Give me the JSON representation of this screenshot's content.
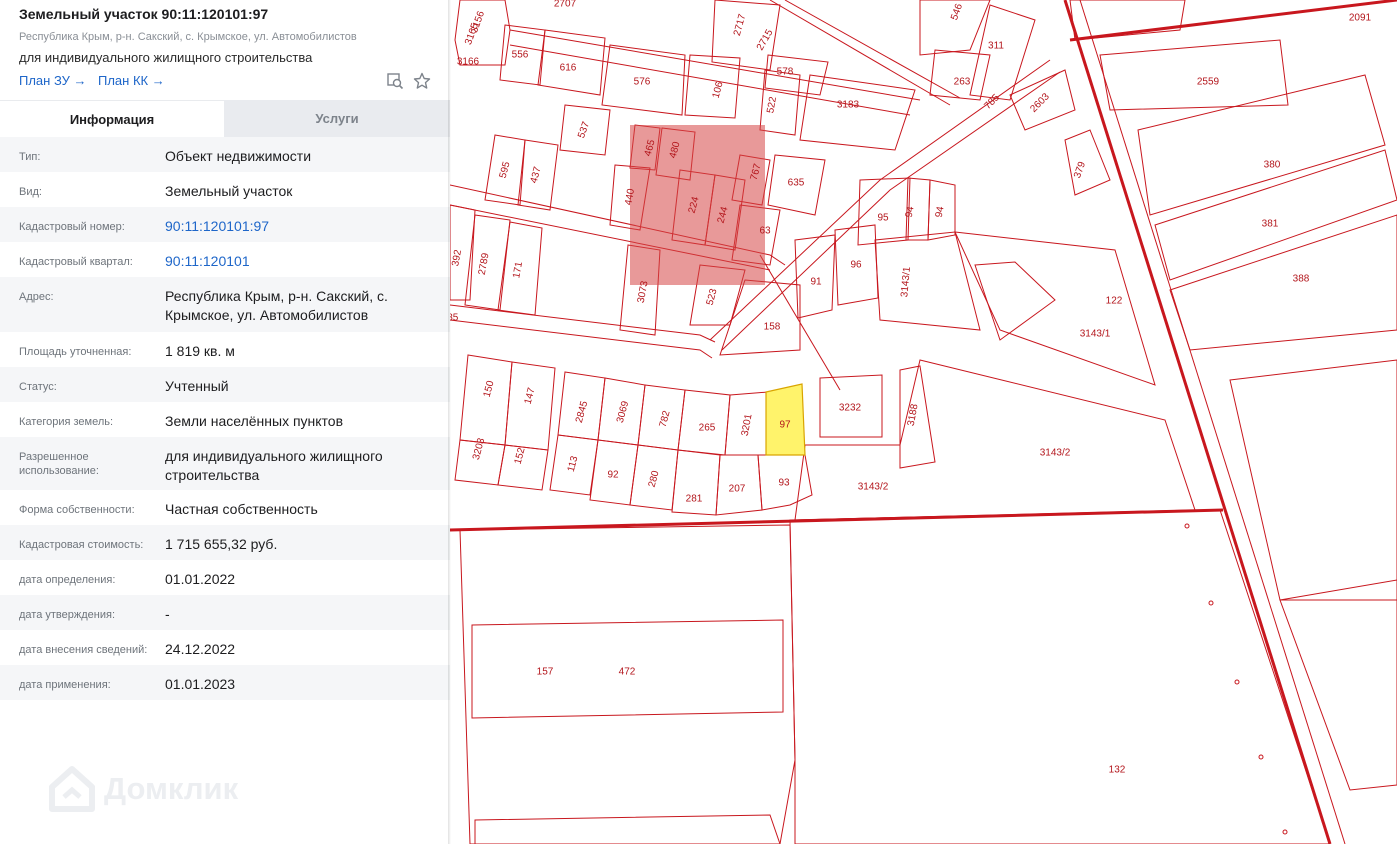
{
  "header": {
    "title": "Земельный участок 90:11:120101:97",
    "address_line": "Республика Крым, р-н. Сакский, с. Крымское, ул. Автомобилистов",
    "use": "для индивидуального жилищного строительства",
    "links": [
      "План ЗУ →",
      "План КК →"
    ],
    "icons": [
      "map-search-icon",
      "star-icon"
    ]
  },
  "tabs": [
    "Информация",
    "Услуги"
  ],
  "rows": [
    {
      "label": "Тип:",
      "value": "Объект недвижимости"
    },
    {
      "label": "Вид:",
      "value": "Земельный участок"
    },
    {
      "label": "Кадастровый номер:",
      "value": "90:11:120101:97",
      "link": true
    },
    {
      "label": "Кадастровый квартал:",
      "value": "90:11:120101",
      "link": true
    },
    {
      "label": "Адрес:",
      "value": "Республика Крым, р-н. Сакский, с. Крымское, ул. Автомобилистов"
    },
    {
      "label": "Площадь уточненная:",
      "value": "1 819 кв. м"
    },
    {
      "label": "Статус:",
      "value": "Учтенный"
    },
    {
      "label": "Категория земель:",
      "value": "Земли населённых пунктов"
    },
    {
      "label": "Разрешенное использование:",
      "value": "для индивидуального жилищного строительства"
    },
    {
      "label": "Форма собственности:",
      "value": "Частная собственность"
    },
    {
      "label": "Кадастровая стоимость:",
      "value": "1 715 655,32 руб."
    },
    {
      "label": "дата определения:",
      "value": "01.01.2022"
    },
    {
      "label": "дата утверждения:",
      "value": "-"
    },
    {
      "label": "дата внесения сведений:",
      "value": "24.12.2022"
    },
    {
      "label": "дата применения:",
      "value": "01.01.2023"
    }
  ],
  "watermark": "Домклик",
  "map": {
    "line_color": "#c8171e",
    "highlight_fill": "#fff36b",
    "parcel_labels": [
      "2707",
      "3166",
      "3165",
      "3156",
      "556",
      "616",
      "576",
      "106",
      "2717",
      "2715",
      "578",
      "546",
      "311",
      "263",
      "2091",
      "522",
      "3183",
      "785",
      "2603",
      "2559",
      "537",
      "465",
      "480",
      "767",
      "635",
      "595",
      "437",
      "440",
      "224",
      "244",
      "63",
      "95",
      "94",
      "94",
      "380",
      "381",
      "379",
      "392",
      "2789",
      "171",
      "3073",
      "523",
      "91",
      "96",
      "3143/1",
      "122",
      "388",
      "785",
      "158",
      "3143/1",
      "150",
      "147",
      "2845",
      "3069",
      "782",
      "265",
      "3201",
      "97",
      "3232",
      "3188",
      "3203",
      "152",
      "113",
      "92",
      "280",
      "281",
      "207",
      "93",
      "3143/2",
      "3143/2",
      "157",
      "472",
      "132"
    ]
  }
}
